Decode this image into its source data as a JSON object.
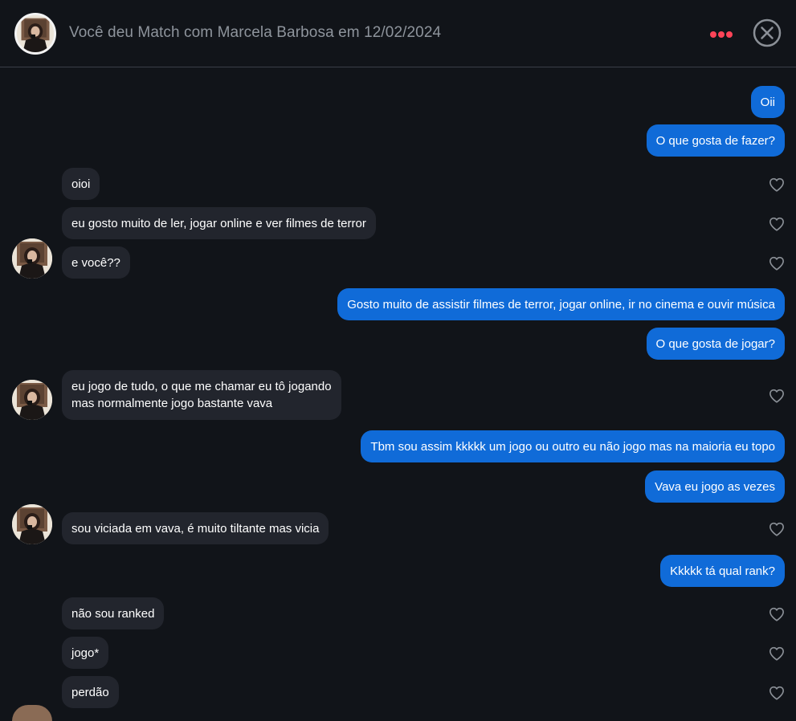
{
  "header": {
    "title": "Você deu Match com Marcela Barbosa em 12/02/2024",
    "more_icon": "more-dots-icon",
    "close_icon": "close-circle-icon",
    "accent_color": "#ff4458"
  },
  "colors": {
    "outgoing_bubble": "#106bd8",
    "incoming_bubble": "#22252d",
    "background": "#111419"
  },
  "messages": [
    {
      "side": "out",
      "text": "Oii"
    },
    {
      "side": "out",
      "text": "O que gosta de fazer?"
    },
    {
      "side": "in",
      "text": "oioi"
    },
    {
      "side": "in",
      "text": "eu gosto muito de ler, jogar online e ver filmes de terror"
    },
    {
      "side": "in",
      "text": "e você??"
    },
    {
      "side": "out",
      "text": "Gosto muito de assistir filmes de terror,  jogar online, ir no cinema e ouvir música"
    },
    {
      "side": "out",
      "text": "O que gosta de jogar?"
    },
    {
      "side": "in",
      "lines": [
        "eu jogo de tudo, o que me chamar eu tô jogando",
        "mas normalmente jogo bastante vava"
      ]
    },
    {
      "side": "out",
      "text": "Tbm sou assim kkkkk um jogo ou outro eu não jogo mas na maioria eu topo"
    },
    {
      "side": "out",
      "text": "Vava eu jogo as vezes"
    },
    {
      "side": "in",
      "text": "sou viciada em vava, é muito tiltante mas vicia"
    },
    {
      "side": "out",
      "text": "Kkkkk tá qual rank?"
    },
    {
      "side": "in",
      "text": "não sou ranked"
    },
    {
      "side": "in",
      "text": "jogo*"
    },
    {
      "side": "in",
      "text": "perdão"
    }
  ]
}
